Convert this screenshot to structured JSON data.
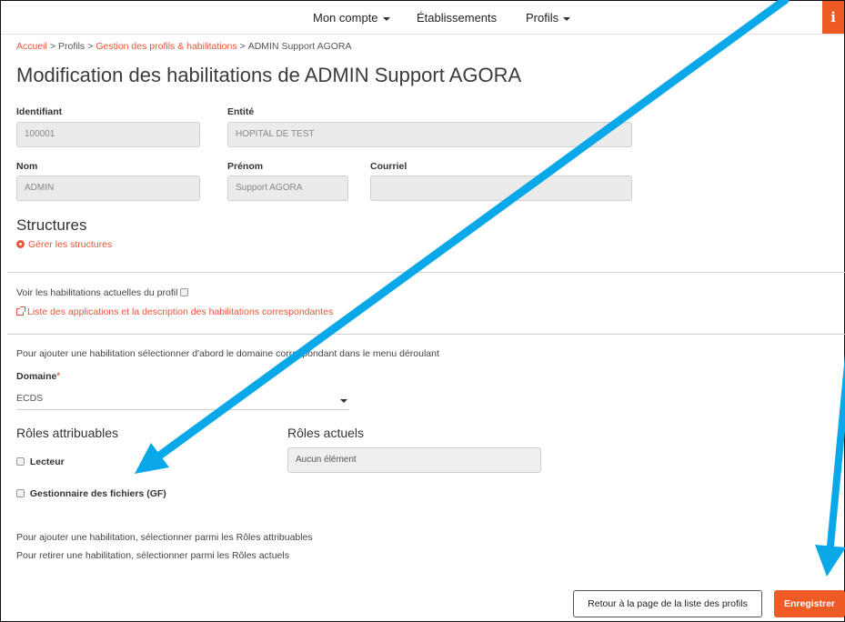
{
  "nav": {
    "account": "Mon compte",
    "establishments": "Établissements",
    "profiles": "Profils",
    "info": "i"
  },
  "breadcrumb": {
    "home": "Accueil",
    "profiles": "Profils",
    "management": "Gestion des profils & habilitations",
    "current": "ADMIN Support AGORA"
  },
  "page": {
    "title": "Modification des habilitations de ADMIN Support AGORA"
  },
  "form": {
    "identifier": {
      "label": "Identifiant",
      "value": "100001"
    },
    "entity": {
      "label": "Entité",
      "value": "HOPITAL DE TEST"
    },
    "last_name": {
      "label": "Nom",
      "value": "ADMIN"
    },
    "first_name": {
      "label": "Prénom",
      "value": "Support AGORA"
    },
    "email": {
      "label": "Courriel",
      "value": ""
    }
  },
  "structures": {
    "title": "Structures",
    "manage_link": "Gérer les structures"
  },
  "habilitations": {
    "show_current": "Voir les habilitations actuelles du profil",
    "apps_link": "Liste des applications et la description des habilitations correspondantes",
    "instruction": "Pour ajouter une habilitation sélectionner d'abord le domaine correspondant dans le menu déroulant"
  },
  "domain": {
    "label": "Domaine",
    "required_mark": "*",
    "selected": "ECDS"
  },
  "roles": {
    "assignable_title": "Rôles attribuables",
    "current_title": "Rôles actuels",
    "current_empty": "Aucun élément",
    "assignable": [
      "Lecteur",
      "Gestionnaire des fichiers (GF)"
    ]
  },
  "help": {
    "add": "Pour ajouter une habilitation, sélectionner parmi les Rôles attribuables",
    "remove": "Pour retirer une habilitation, sélectionner parmi les Rôles actuels"
  },
  "actions": {
    "back": "Retour à la page de la liste des profils",
    "save": "Enregistrer"
  },
  "colors": {
    "accent": "#ee5a24",
    "link": "#e8553b",
    "annotation_arrow": "#0aa8e8"
  }
}
